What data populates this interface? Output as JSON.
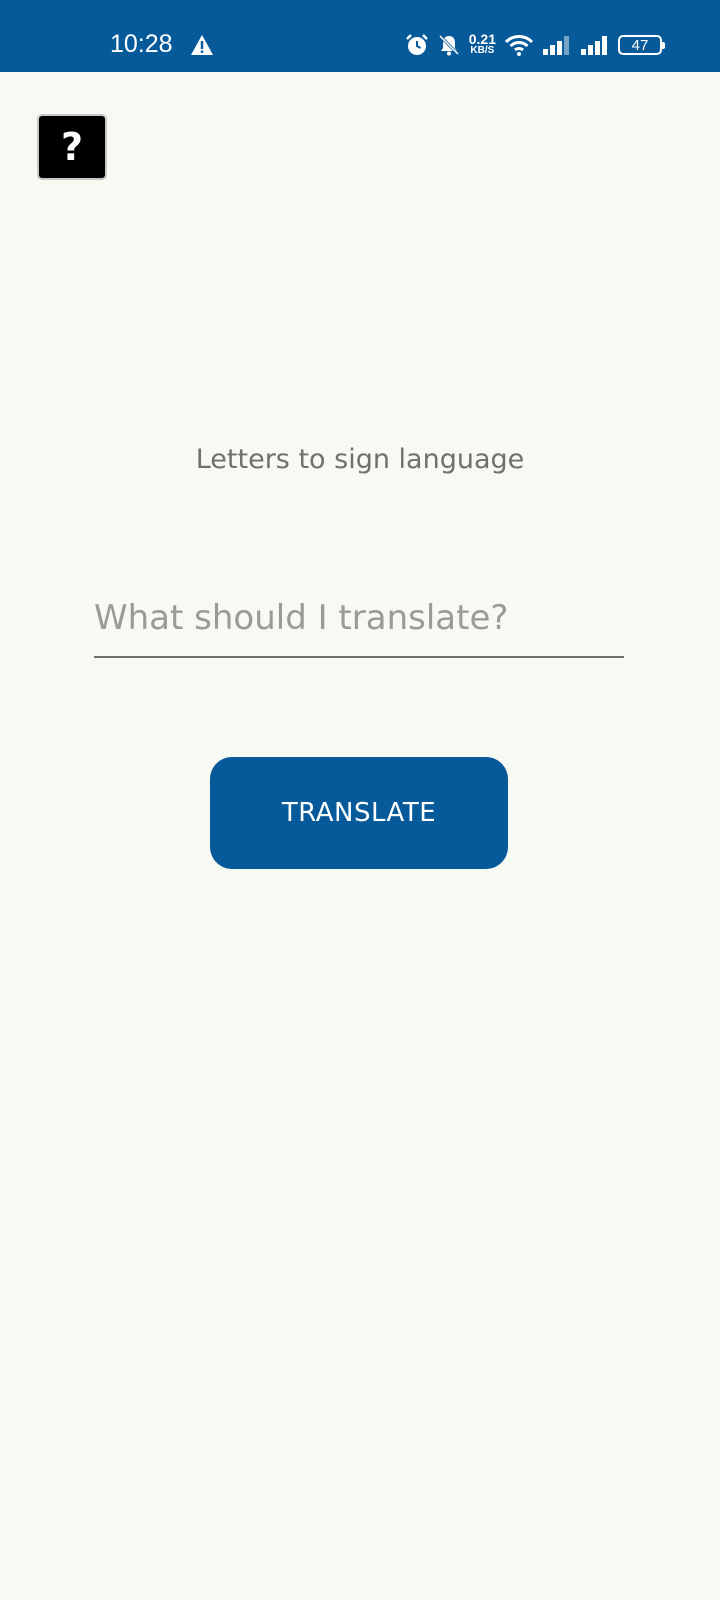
{
  "status_bar": {
    "time": "10:28",
    "net_speed_value": "0.21",
    "net_speed_unit": "KB/S",
    "battery_level": "47",
    "icons": [
      "warning-icon",
      "alarm-icon",
      "bell-off-icon",
      "wifi-icon",
      "signal-icon",
      "signal-icon",
      "battery-icon"
    ]
  },
  "help_button": {
    "label": "?"
  },
  "main": {
    "subtitle": "Letters to sign language",
    "input_placeholder": "What should I translate?",
    "input_value": "",
    "translate_label": "TRANSLATE"
  },
  "colors": {
    "primary": "#075a9a",
    "background": "#f7faf3",
    "text_muted": "#707070"
  }
}
